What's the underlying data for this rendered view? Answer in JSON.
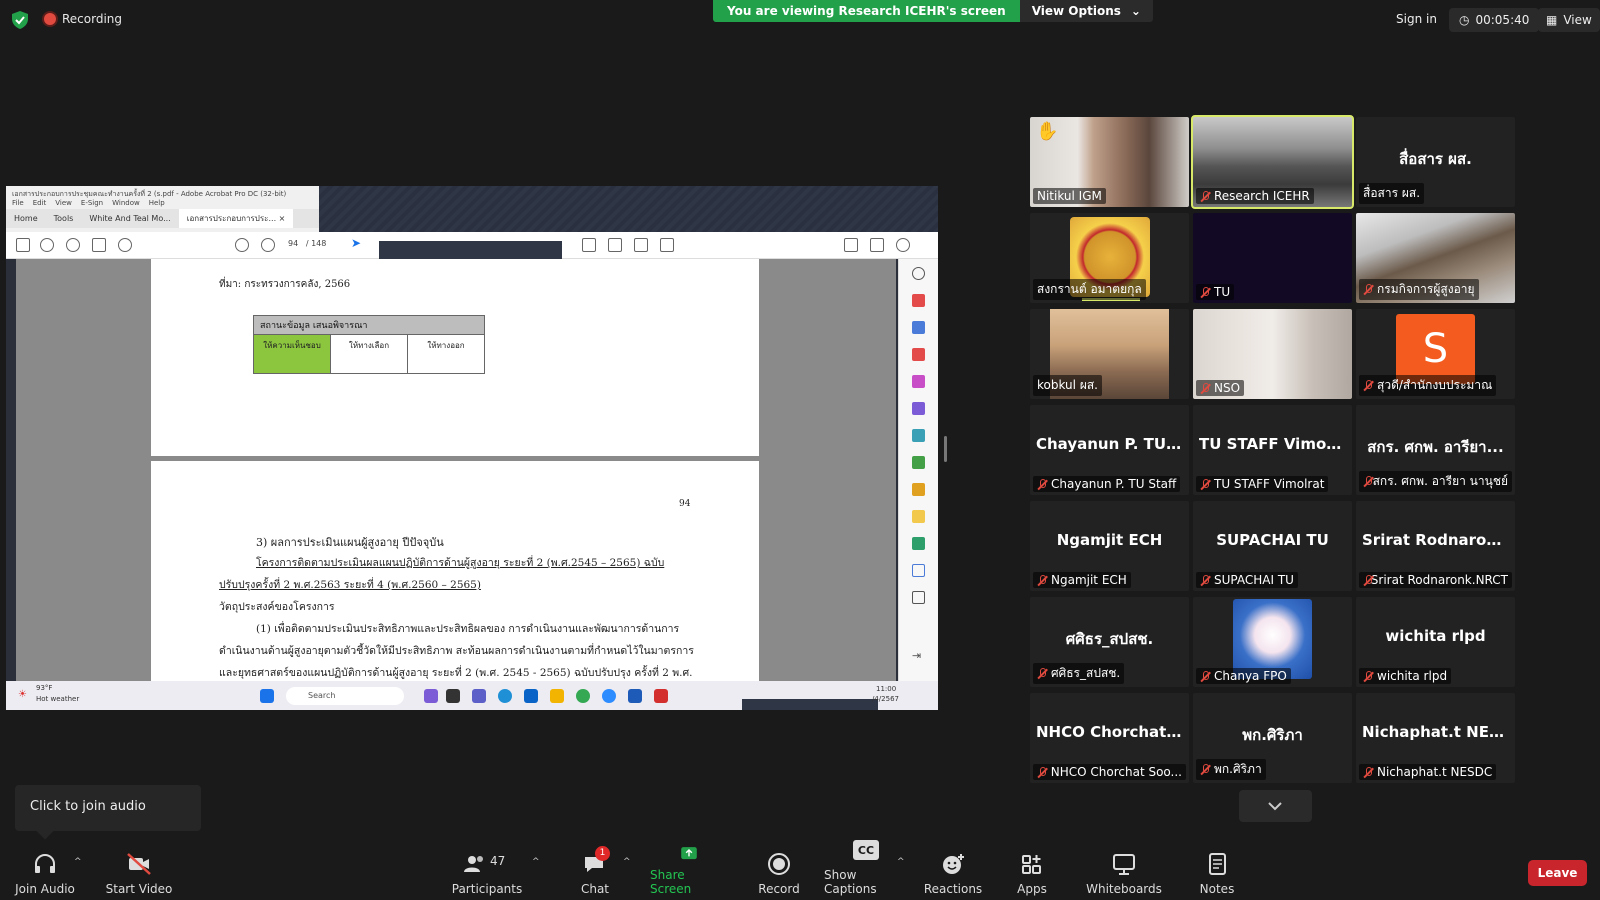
{
  "topbar": {
    "recording": "Recording",
    "viewing": "You are viewing Research ICEHR's screen",
    "view_options": "View Options",
    "sign_in": "Sign in",
    "timer": "00:05:40",
    "view": "View"
  },
  "share": {
    "window_title": "เอกสารประกอบการประชุมคณะทำงานครั้งที่ 2 (s.pdf - Adobe Acrobat Pro DC (32-bit)",
    "menu": [
      "File",
      "Edit",
      "View",
      "E-Sign",
      "Window",
      "Help"
    ],
    "tabs": [
      "Home",
      "Tools",
      "White And Teal Mo...",
      "เอกสารประกอบการประ..."
    ],
    "page_current": "94",
    "page_total": "/ 148",
    "source_line": "ที่มา: กระทรวงการคลัง, 2566",
    "table_header": "สถานะข้อมูล เสนอพิจารณา",
    "table_cells": [
      "ให้ความเห็นชอบ",
      "ให้ทางเลือก",
      "ให้ทางออก"
    ],
    "page2_num": "94",
    "heading": "3) ผลการประเมินแผนผู้สูงอายุ ปีปัจจุบัน",
    "line1": "โครงการติดตามประเมินผลแผนปฏิบัติการด้านผู้สูงอายุ ระยะที่ 2 (พ.ศ.2545 – 2565) ฉบับ",
    "line2": "ปรับปรุงครั้งที่ 2 พ.ศ.2563 ระยะที่ 4 (พ.ศ.2560 – 2565)",
    "line3": "วัตถุประสงค์ของโครงการ",
    "line4": "(1) เพื่อติดตามประเมินประสิทธิภาพและประสิทธิผลของ การดำเนินงานและพัฒนาการด้านการ",
    "line5": "ดำเนินงานด้านผู้สูงอายุตามตัวชี้วัดให้มีประสิทธิภาพ สะท้อนผลการดำเนินงานตามที่กำหนดไว้ในมาตรการ",
    "line6": "และยุทธศาสตร์ของแผนปฏิบัติการด้านผู้สูงอายุ ระยะที่ 2 (พ.ศ. 2545 - 2565) ฉบับปรับปรุง ครั้งที่ 2 พ.ศ.",
    "weather_temp": "93°F",
    "weather_desc": "Hot weather",
    "search": "Search",
    "clock_time": "11:00",
    "clock_date": "/4/2567"
  },
  "tiles": [
    {
      "big": "",
      "label": "Nitikul IGM",
      "muted": false
    },
    {
      "big": "",
      "label": "Research ICEHR",
      "muted": true
    },
    {
      "big": "สื่อสาร ผส.",
      "label": "สื่อสาร ผส.",
      "muted": false
    },
    {
      "big": "",
      "label": "สงกรานต์ อมาตยกุล",
      "muted": false
    },
    {
      "big": "",
      "label": "TU",
      "muted": true
    },
    {
      "big": "",
      "label": "กรมกิจการผู้สูงอายุ",
      "muted": true
    },
    {
      "big": "",
      "label": "kobkul ผส.",
      "muted": false
    },
    {
      "big": "",
      "label": "NSO",
      "muted": true
    },
    {
      "big": "S",
      "label": "สุวดี/สำนักงบประมาณ",
      "muted": true
    },
    {
      "big": "Chayanun P. TU...",
      "label": "Chayanun P. TU Staff",
      "muted": true
    },
    {
      "big": "TU STAFF Vimol...",
      "label": "TU STAFF Vimolrat",
      "muted": true
    },
    {
      "big": "สกร. ศกพ. อารียา...",
      "label": "สกร. ศกพ. อารียา นานุชย์",
      "muted": true
    },
    {
      "big": "Ngamjit ECH",
      "label": "Ngamjit ECH",
      "muted": true
    },
    {
      "big": "SUPACHAI TU",
      "label": "SUPACHAI TU",
      "muted": true
    },
    {
      "big": "Srirat  Rodnaron...",
      "label": "Srirat Rodnaronk.NRCT",
      "muted": true
    },
    {
      "big": "ศศิธร_สปสช.",
      "label": "ศศิธร_สปสช.",
      "muted": true
    },
    {
      "big": "",
      "label": "Chanya FPO",
      "muted": true
    },
    {
      "big": "wichita rlpd",
      "label": "wichita rlpd",
      "muted": true
    },
    {
      "big": "NHCO  Chorchat...",
      "label": "NHCO Chorchat Soo...",
      "muted": true
    },
    {
      "big": "พก.ศิริภา",
      "label": "พก.ศิริภา",
      "muted": true
    },
    {
      "big": "Nichaphat.t  NES...",
      "label": "Nichaphat.t NESDC",
      "muted": true
    }
  ],
  "bottom": {
    "join_tip": "Click to join audio",
    "join_audio": "Join Audio",
    "start_video": "Start Video",
    "participants": "Participants",
    "participants_count": "47",
    "chat": "Chat",
    "chat_badge": "1",
    "share_screen": "Share Screen",
    "record": "Record",
    "captions": "Show Captions",
    "captions_icon": "CC",
    "reactions": "Reactions",
    "apps": "Apps",
    "whiteboards": "Whiteboards",
    "notes": "Notes",
    "leave": "Leave"
  },
  "colors": {
    "green": "#23a14a",
    "leave": "#c9252c",
    "active_speaker": "#d8e96a",
    "muted": "#e04a3f"
  }
}
